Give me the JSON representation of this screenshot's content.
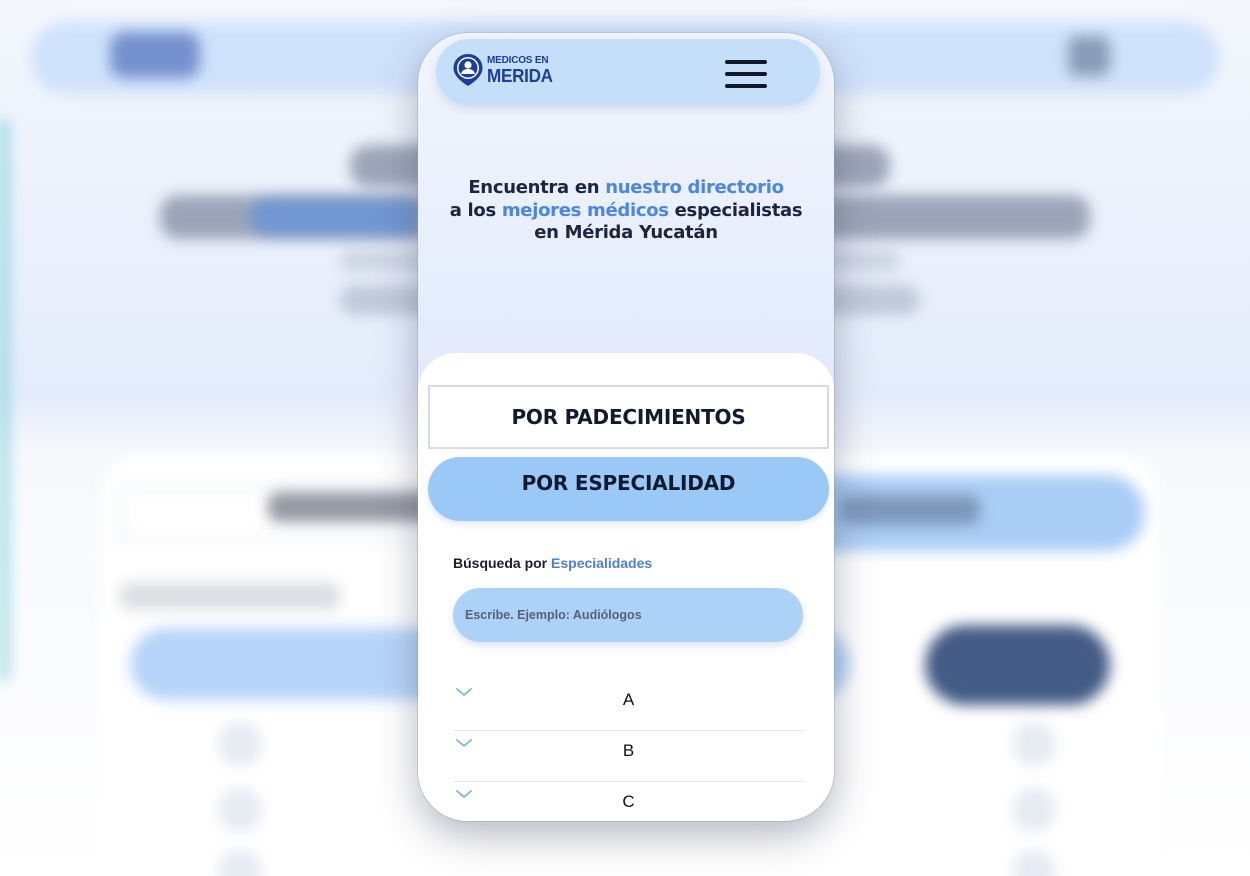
{
  "logo": {
    "line1": "MEDICOS EN",
    "line2": "MERIDA",
    "icon": "map-pin-doctor-icon"
  },
  "menu": {
    "icon": "hamburger-menu-icon"
  },
  "hero": {
    "part1": "Encuentra en ",
    "highlight1": "nuestro directorio",
    "part2": "a los ",
    "highlight2": "mejores médicos",
    "part3": " especialistas",
    "part4": "en Mérida Yucatán"
  },
  "tabs": {
    "padecimientos": "POR PADECIMIENTOS",
    "especialidad": "POR ESPECIALIDAD"
  },
  "search": {
    "label_prefix": "Búsqueda por ",
    "label_highlight": "Especialidades",
    "placeholder": "Escribe. Ejemplo: Audiólogos"
  },
  "accordion": {
    "icon": "chevron-down-icon",
    "items": [
      {
        "letter": "A"
      },
      {
        "letter": "B"
      },
      {
        "letter": "C"
      }
    ]
  },
  "colors": {
    "header_bg": "#c5dffa",
    "accent_blue": "#4a86e8",
    "brand_navy": "#1c3e9c",
    "active_tab": "#9ac8f7",
    "search_bg": "#acd2f8"
  }
}
